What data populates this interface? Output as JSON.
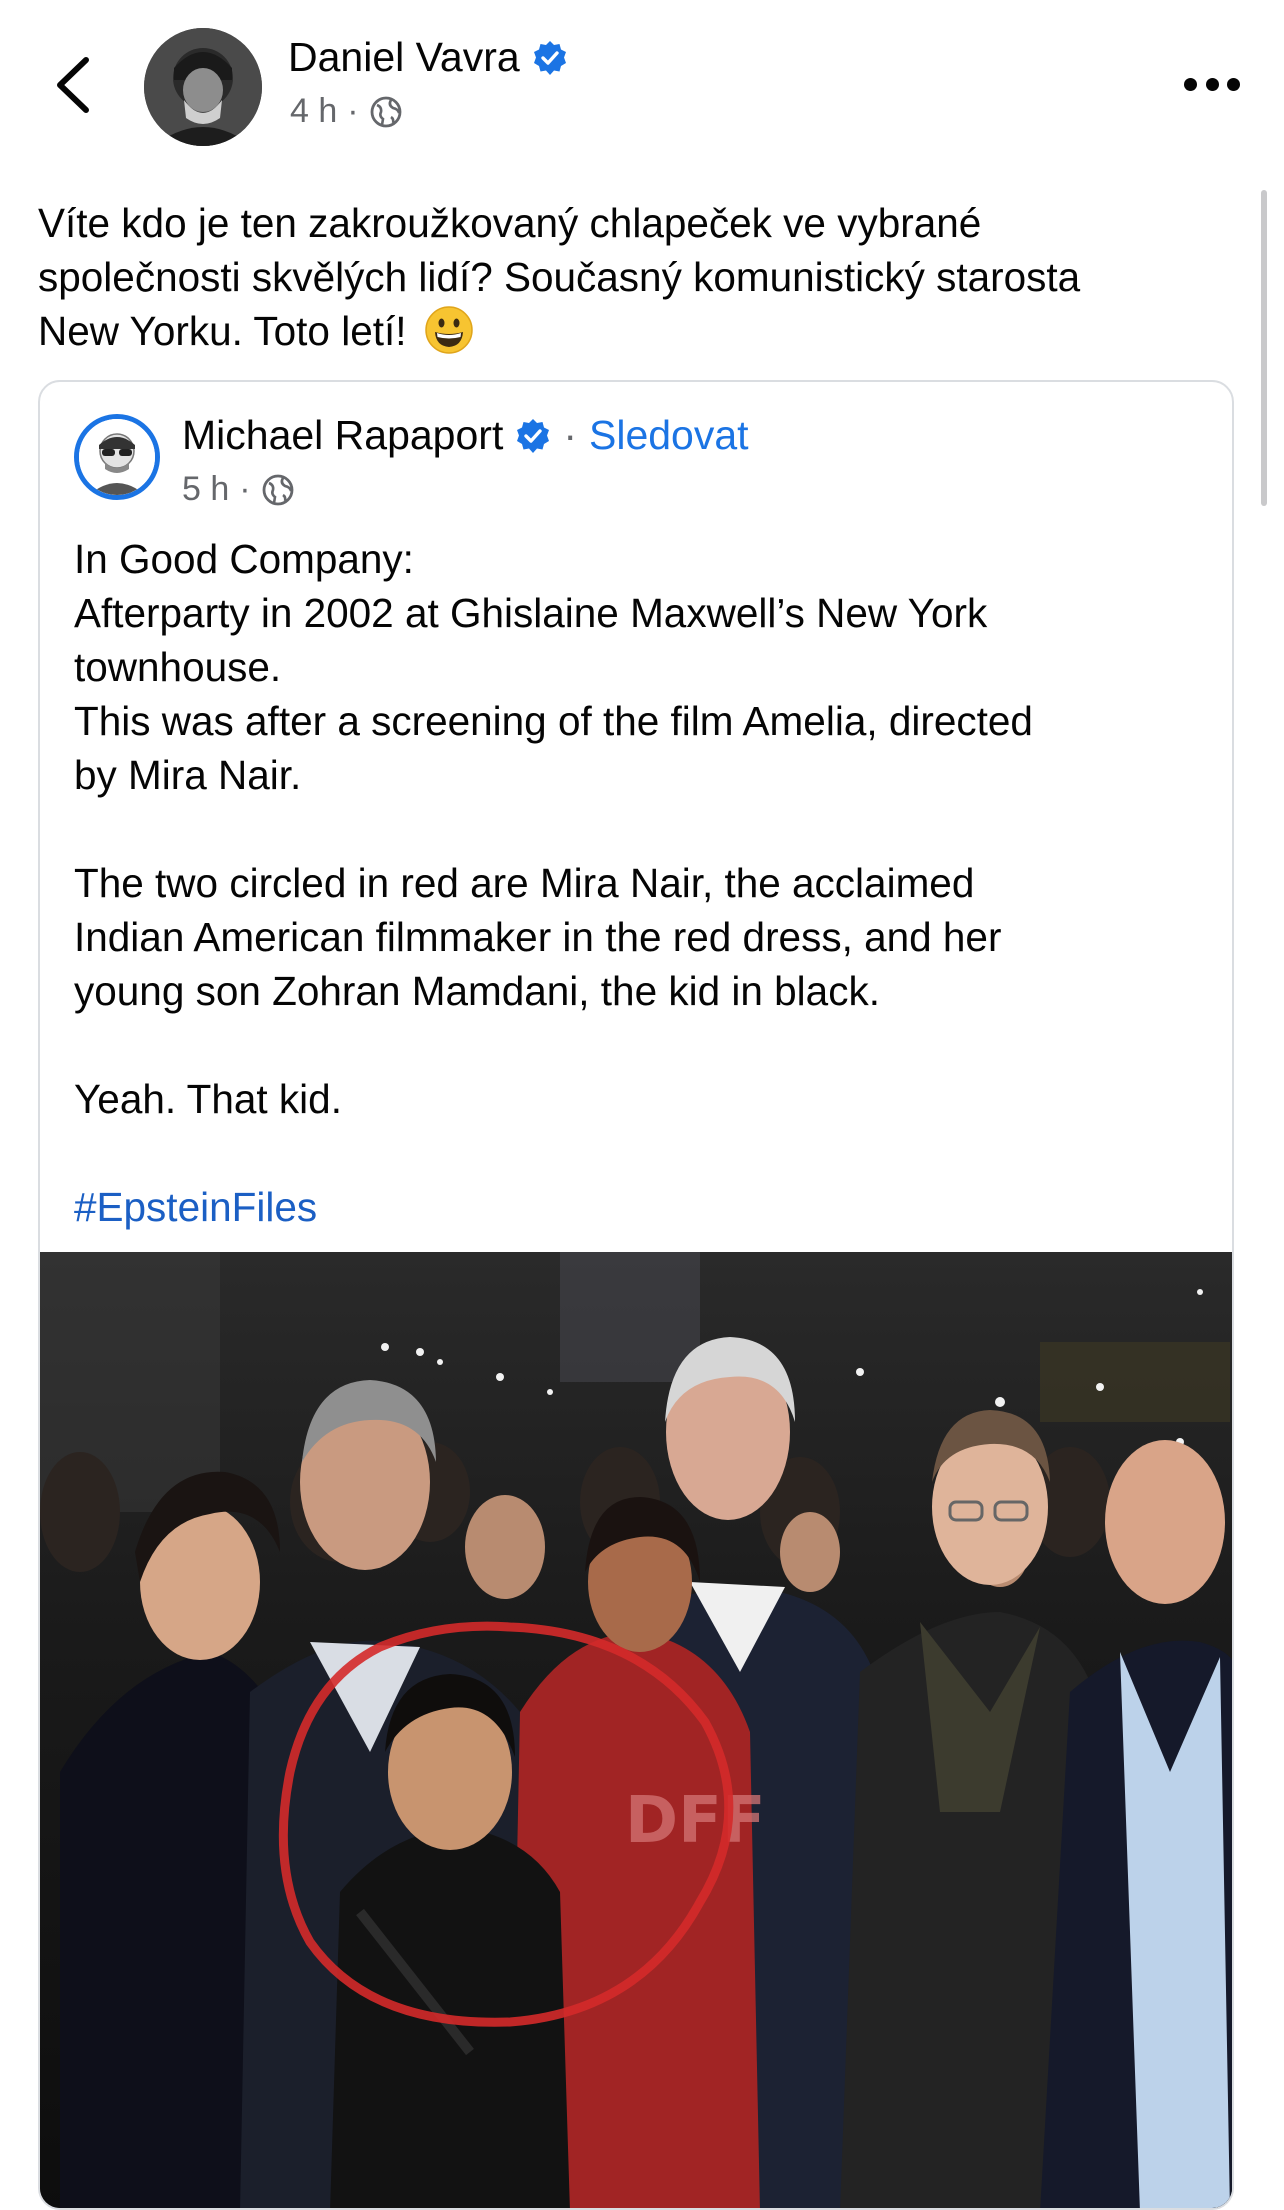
{
  "post": {
    "author": "Daniel Vavra",
    "time": "4 h",
    "dot": "·",
    "text_lines": [
      "Víte kdo je ten zakroužkovaný chlapeček ve vybrané",
      "společnosti skvělých lidí? Současný komunistický starosta",
      "New Yorku. Toto letí!"
    ]
  },
  "shared": {
    "author": "Michael Rapaport",
    "follow_sep": "·",
    "follow_label": "Sledovat",
    "time": "5 h",
    "dot": "·",
    "paragraphs": [
      "In Good Company:",
      "Afterparty in 2002 at Ghislaine Maxwell’s New York",
      "townhouse.",
      "This was after a screening of the film Amelia, directed",
      "by Mira Nair.",
      "",
      "The two circled in red are Mira Nair, the acclaimed",
      "Indian American filmmaker in the red dress, and her",
      "young son Zohran Mamdani, the kid in black.",
      "",
      "Yeah. That kid.",
      ""
    ],
    "hashtag": "#EpsteinFiles",
    "photo_watermark": "DFF"
  },
  "icons": {
    "back": "chevron-left-icon",
    "more": "more-horizontal-icon",
    "verified": "verified-badge-icon",
    "globe": "globe-icon",
    "emoji": "grinning-face-emoji"
  },
  "colors": {
    "accent": "#1b74e4",
    "text": "#050505",
    "secondary": "#65676b",
    "circle": "#d42a2a"
  }
}
